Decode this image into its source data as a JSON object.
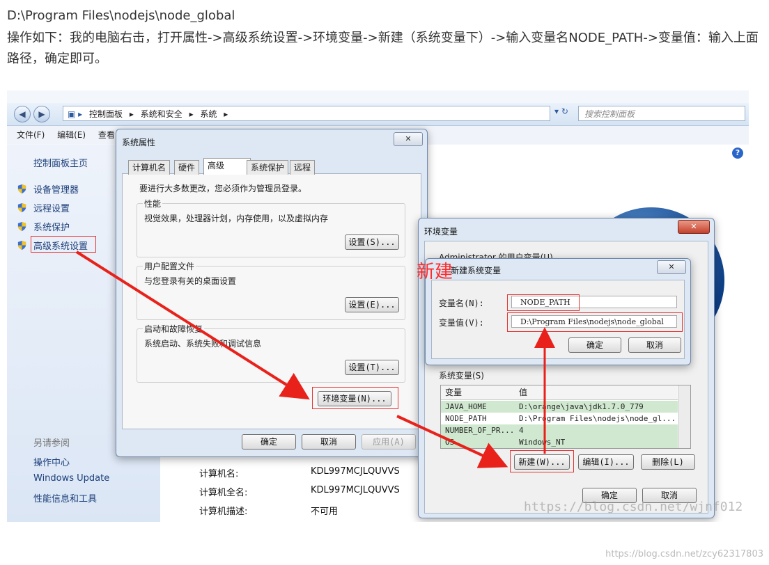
{
  "article": {
    "line1": "D:\\Program Files\\nodejs\\node_global",
    "line2": "操作如下：我的电脑右击，打开属性->高级系统设置->环境变量->新建（系统变量下）->输入变量名NODE_PATH->变量值：输入上面路径，确定即可。"
  },
  "explorer": {
    "breadcrumbs": [
      "控制面板",
      "系统和安全",
      "系统"
    ],
    "search_placeholder": "搜索控制面板",
    "menu": [
      "文件(F)",
      "编辑(E)",
      "查看"
    ],
    "left_pane": {
      "home": "控制面板主页",
      "links": [
        "设备管理器",
        "远程设置",
        "系统保护",
        "高级系统设置"
      ],
      "see_also_title": "另请参阅",
      "see_also": [
        "操作中心",
        "Windows Update",
        "性能信息和工具"
      ]
    },
    "computer_info": [
      {
        "label": "计算机名:",
        "value": "KDL997MCJLQUVVS"
      },
      {
        "label": "计算机全名:",
        "value": "KDL997MCJLQUVVS"
      },
      {
        "label": "计算机描述:",
        "value": "不可用"
      }
    ]
  },
  "sys_props": {
    "title": "系统属性",
    "tabs": [
      "计算机名",
      "硬件",
      "高级",
      "系统保护",
      "远程"
    ],
    "admin_note": "要进行大多数更改，您必须作为管理员登录。",
    "perf_title": "性能",
    "perf_desc": "视觉效果，处理器计划，内存使用，以及虚拟内存",
    "profile_title": "用户配置文件",
    "profile_desc": "与您登录有关的桌面设置",
    "startup_title": "启动和故障恢复",
    "startup_desc": "系统启动、系统失败和调试信息",
    "settings_s": "设置(S)...",
    "settings_e": "设置(E)...",
    "settings_t": "设置(T)...",
    "env_button": "环境变量(N)...",
    "ok": "确定",
    "cancel": "取消",
    "apply": "应用(A)"
  },
  "env_vars": {
    "title": "环境变量",
    "user_vars_label": "Administrator 的用户变量(U)",
    "sys_vars_label": "系统变量(S)",
    "col_var": "变量",
    "col_val": "值",
    "rows": [
      {
        "name": "JAVA_HOME",
        "value": "D:\\orange\\java\\jdk1.7.0_779"
      },
      {
        "name": "NODE_PATH",
        "value": "D:\\Program Files\\nodejs\\node_gl..."
      },
      {
        "name": "NUMBER_OF_PR...",
        "value": "4"
      },
      {
        "name": "OS",
        "value": "Windows_NT"
      }
    ],
    "new_btn": "新建(W)...",
    "edit_btn": "编辑(I)...",
    "delete_btn": "删除(L)",
    "ok": "确定",
    "cancel": "取消"
  },
  "new_var": {
    "title": "新建系统变量",
    "name_label": "变量名(N):",
    "name_value": "NODE_PATH",
    "value_label": "变量值(V):",
    "value_value": "D:\\Program Files\\nodejs\\node_global",
    "ok": "确定",
    "cancel": "取消"
  },
  "annotation": {
    "new_label": "新建",
    "watermark_inner": "https://blog.csdn.net/wjnf012",
    "watermark_footer": "https://blog.csdn.net/zcy62317803"
  },
  "colors": {
    "arrow": "#e8211b",
    "highlight_box": "#e53333"
  }
}
